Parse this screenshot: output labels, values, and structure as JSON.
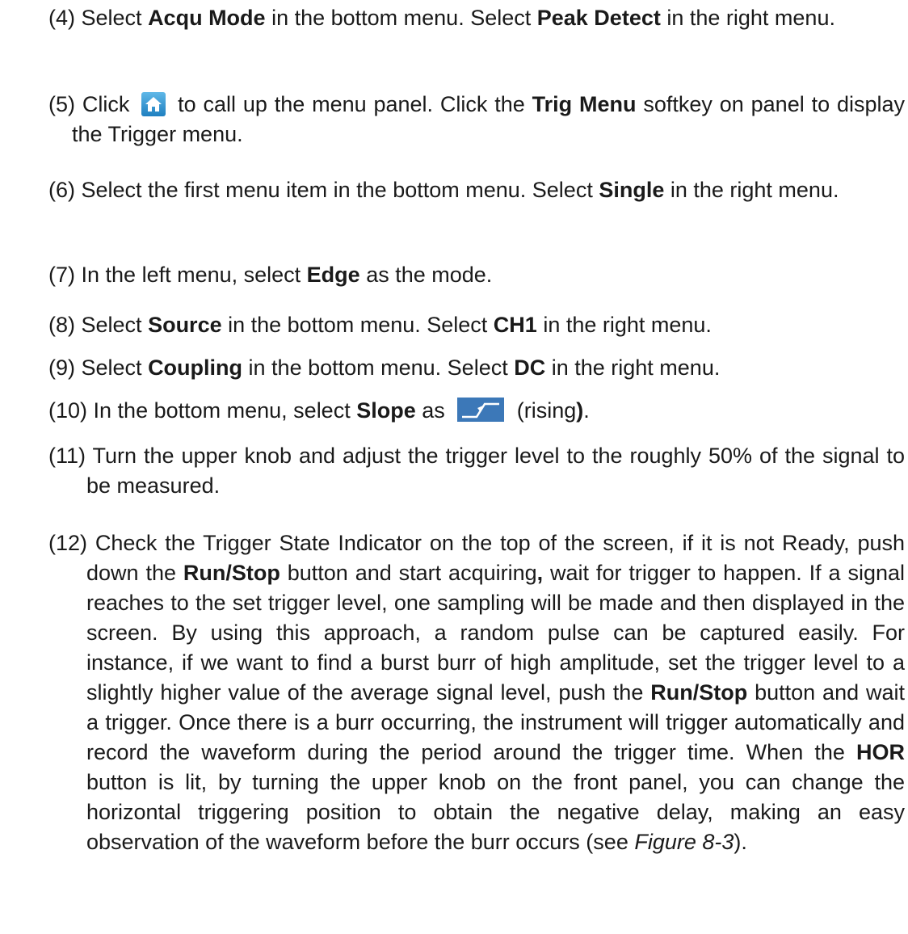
{
  "steps": [
    {
      "number": "(4)",
      "t1": "Select ",
      "b1": "Acqu Mode",
      "t2": " in the bottom menu. Select ",
      "b2": "Peak Detect",
      "t3": " in the right menu."
    },
    {
      "number": "(5)",
      "t1": "Click ",
      "icon": "home-icon",
      "t2": " to call up the menu panel. Click the ",
      "b1": "Trig Menu",
      "t3": " softkey on panel to display the Trigger menu."
    },
    {
      "number": "(6)",
      "t1": "Select the first menu item in the bottom menu. Select ",
      "b1": "Single",
      "t2": " in the right menu."
    },
    {
      "number": "(7)",
      "t1": "In the left menu, select ",
      "b1": "Edge",
      "t2": " as the mode."
    },
    {
      "number": "(8)",
      "t1": "Select ",
      "b1": "Source",
      "t2": " in the bottom menu. Select ",
      "b2": "CH1",
      "t3": " in the right menu."
    },
    {
      "number": "(9)",
      "t1": "Select ",
      "b1": "Coupling",
      "t2": " in the bottom menu. Select ",
      "b2": "DC",
      "t3": " in the right menu."
    },
    {
      "number": "(10)",
      "t1": "In the bottom menu, select ",
      "b1": "Slope",
      "t2": " as ",
      "icon": "rising-slope-icon",
      "t3": " (rising",
      "b2": ")",
      "t4": "."
    },
    {
      "number": "(11)",
      "t1": "Turn the upper knob and adjust the trigger level to the roughly 50% of the signal to be measured."
    },
    {
      "number": "(12)",
      "t1": "Check the Trigger State Indicator on the top of the screen, if it is not Ready, push down the ",
      "b1": "Run/Stop",
      "t2": " button and start acquiring",
      "b2": ",",
      "t3": " wait for trigger to happen. If a signal reaches to the set trigger level, one sampling will be made and then displayed in the screen. By using this approach, a random pulse can be captured easily. For instance, if we want to find a burst burr of high amplitude, set the trigger level to a slightly higher value of the average signal level, push the ",
      "b3": "Run/Stop",
      "t4": " button and wait a trigger. Once there is a burr occurring, the instrument will trigger automatically and record the waveform during the period around the trigger time. When the ",
      "b4": "HOR",
      "t5": " button is lit, by turning the upper knob on the front panel, you can change the horizontal triggering position to obtain the negative delay, making an easy observation of the waveform before the burr occurs (see ",
      "i1": "Figure 8-3",
      "t6": ")."
    }
  ],
  "colors": {
    "text": "#1a1a1a",
    "home_icon": "#2a8fd0",
    "slope_icon": "#3c78b8"
  }
}
